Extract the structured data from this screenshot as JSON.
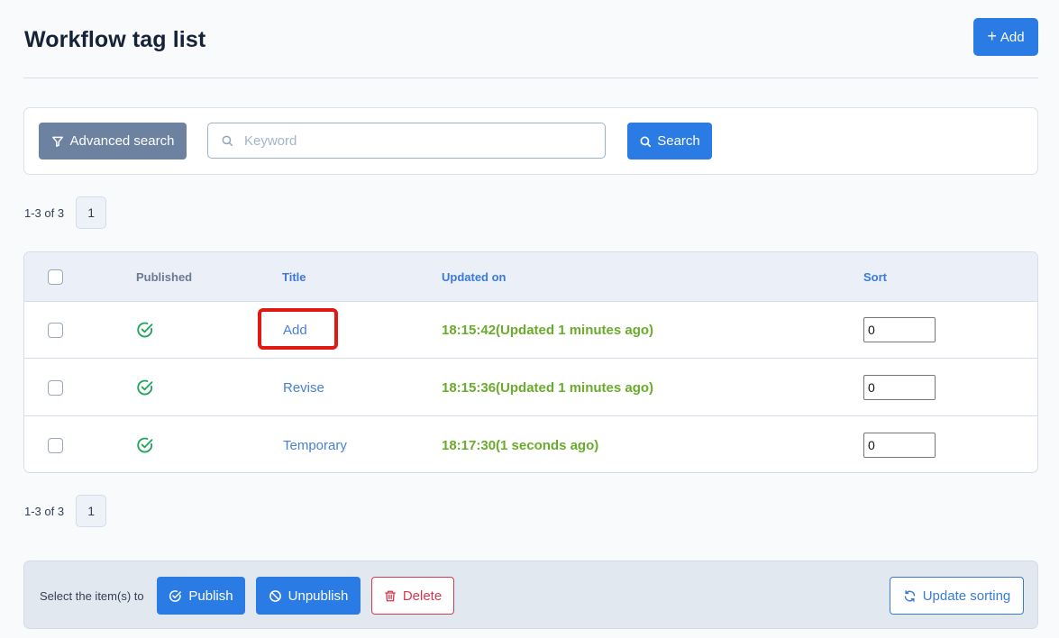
{
  "header": {
    "title": "Workflow tag list",
    "add_button": {
      "icon": "plus-icon",
      "label": "Add"
    }
  },
  "search": {
    "advanced_button": {
      "icon": "filter-icon",
      "label": "Advanced search"
    },
    "keyword_input": {
      "icon": "search-icon",
      "placeholder": "Keyword",
      "value": ""
    },
    "search_button": {
      "icon": "search-icon",
      "label": "Search"
    }
  },
  "pagination_top": {
    "count_text": "1-3 of 3",
    "current_page": "1"
  },
  "table": {
    "columns": {
      "select_all": "",
      "published": "Published",
      "title": "Title",
      "updated_on": "Updated on",
      "sort": "Sort"
    },
    "rows": [
      {
        "checked": false,
        "published": true,
        "published_icon": "check-circle-icon",
        "title": "Add",
        "updated_on": "18:15:42(Updated 1 minutes ago)",
        "sort": "0",
        "highlighted": true
      },
      {
        "checked": false,
        "published": true,
        "published_icon": "check-circle-icon",
        "title": "Revise",
        "updated_on": "18:15:36(Updated 1 minutes ago)",
        "sort": "0",
        "highlighted": false
      },
      {
        "checked": false,
        "published": true,
        "published_icon": "check-circle-icon",
        "title": "Temporary",
        "updated_on": "18:17:30(1 seconds ago)",
        "sort": "0",
        "highlighted": false
      }
    ]
  },
  "pagination_bottom": {
    "count_text": "1-3 of 3",
    "current_page": "1"
  },
  "bulk_actions": {
    "label": "Select the item(s) to",
    "publish": {
      "icon": "check-circle-icon",
      "label": "Publish"
    },
    "unpublish": {
      "icon": "ban-icon",
      "label": "Unpublish"
    },
    "delete": {
      "icon": "trash-icon",
      "label": "Delete"
    },
    "update_sorting": {
      "icon": "refresh-icon",
      "label": "Update sorting"
    }
  },
  "colors": {
    "primary": "#2b7be4",
    "secondary": "#6c82a0",
    "danger": "#d9394f",
    "success": "#6aab2c",
    "published_icon": "#22a55a",
    "highlight": "#e01a13"
  }
}
